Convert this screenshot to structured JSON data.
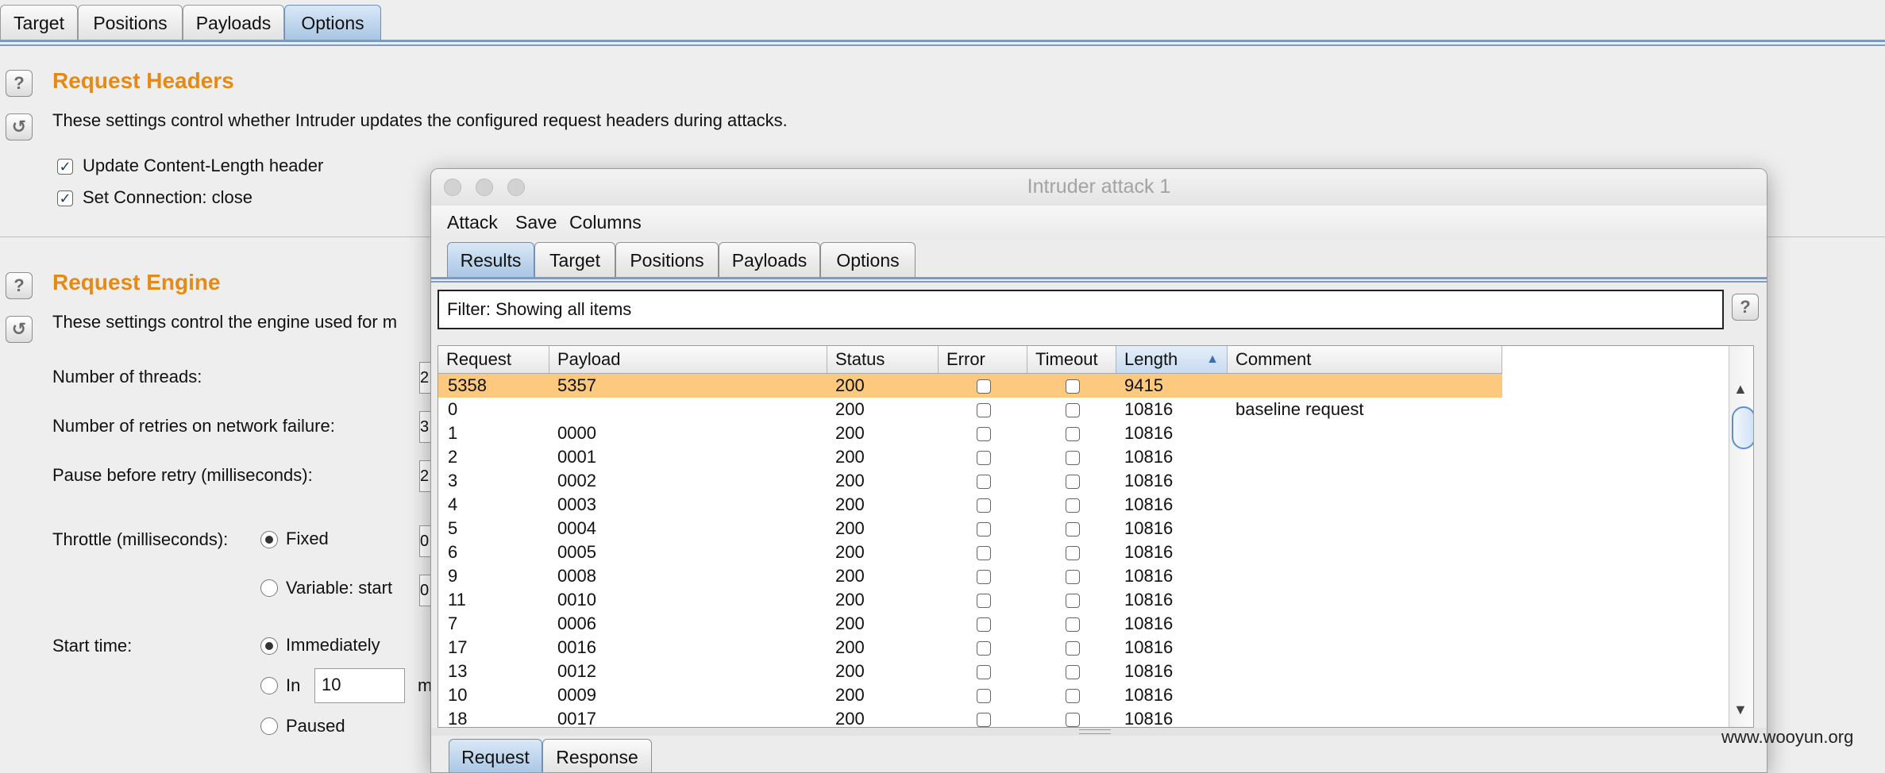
{
  "main": {
    "tabs": [
      {
        "label": "Target"
      },
      {
        "label": "Positions"
      },
      {
        "label": "Payloads"
      },
      {
        "label": "Options",
        "active": true
      }
    ],
    "request_headers": {
      "title": "Request Headers",
      "description": "These settings control whether Intruder updates the configured request headers during attacks.",
      "update_content_length": {
        "label": "Update Content-Length header",
        "checked": true
      },
      "set_connection_close": {
        "label": "Set Connection: close",
        "checked": true
      }
    },
    "request_engine": {
      "title": "Request Engine",
      "description": "These settings control the engine used for m",
      "threads_label": "Number of threads:",
      "threads_value": "2",
      "retries_label": "Number of retries on network failure:",
      "retries_value": "3",
      "pause_label": "Pause before retry (milliseconds):",
      "pause_value": "2",
      "throttle_label": "Throttle (milliseconds):",
      "throttle_value": "0",
      "throttle_fixed": "Fixed",
      "throttle_variable": "Variable:  start",
      "variable_value": "0",
      "start_time_label": "Start time:",
      "start_immediately": "Immediately",
      "start_in": "In",
      "start_in_value": "10",
      "start_in_unit": "m",
      "start_paused": "Paused"
    }
  },
  "attack_window": {
    "title": "Intruder attack 1",
    "menu": [
      "Attack",
      "Save",
      "Columns"
    ],
    "tabs": [
      {
        "label": "Results",
        "active": true
      },
      {
        "label": "Target"
      },
      {
        "label": "Positions"
      },
      {
        "label": "Payloads"
      },
      {
        "label": "Options"
      }
    ],
    "filter_text": "Filter: Showing all items",
    "columns": [
      "Request",
      "Payload",
      "Status",
      "Error",
      "Timeout",
      "Length",
      "Comment"
    ],
    "sort_column": "Length",
    "rows": [
      {
        "request": "5358",
        "payload": "5357",
        "status": "200",
        "length": "9415",
        "comment": "",
        "selected": true
      },
      {
        "request": "0",
        "payload": "",
        "status": "200",
        "length": "10816",
        "comment": "baseline request"
      },
      {
        "request": "1",
        "payload": "0000",
        "status": "200",
        "length": "10816",
        "comment": ""
      },
      {
        "request": "2",
        "payload": "0001",
        "status": "200",
        "length": "10816",
        "comment": ""
      },
      {
        "request": "3",
        "payload": "0002",
        "status": "200",
        "length": "10816",
        "comment": ""
      },
      {
        "request": "4",
        "payload": "0003",
        "status": "200",
        "length": "10816",
        "comment": ""
      },
      {
        "request": "5",
        "payload": "0004",
        "status": "200",
        "length": "10816",
        "comment": ""
      },
      {
        "request": "6",
        "payload": "0005",
        "status": "200",
        "length": "10816",
        "comment": ""
      },
      {
        "request": "9",
        "payload": "0008",
        "status": "200",
        "length": "10816",
        "comment": ""
      },
      {
        "request": "11",
        "payload": "0010",
        "status": "200",
        "length": "10816",
        "comment": ""
      },
      {
        "request": "7",
        "payload": "0006",
        "status": "200",
        "length": "10816",
        "comment": ""
      },
      {
        "request": "17",
        "payload": "0016",
        "status": "200",
        "length": "10816",
        "comment": ""
      },
      {
        "request": "13",
        "payload": "0012",
        "status": "200",
        "length": "10816",
        "comment": ""
      },
      {
        "request": "10",
        "payload": "0009",
        "status": "200",
        "length": "10816",
        "comment": ""
      },
      {
        "request": "18",
        "payload": "0017",
        "status": "200",
        "length": "10816",
        "comment": ""
      }
    ],
    "bottom_tabs": [
      {
        "label": "Request",
        "active": true
      },
      {
        "label": "Response"
      }
    ]
  },
  "watermark": "www.wooyun.org",
  "colors": {
    "section_title": "#e58a14",
    "selected_row": "#fcc97e",
    "tab_active": "#a9c6e4"
  }
}
